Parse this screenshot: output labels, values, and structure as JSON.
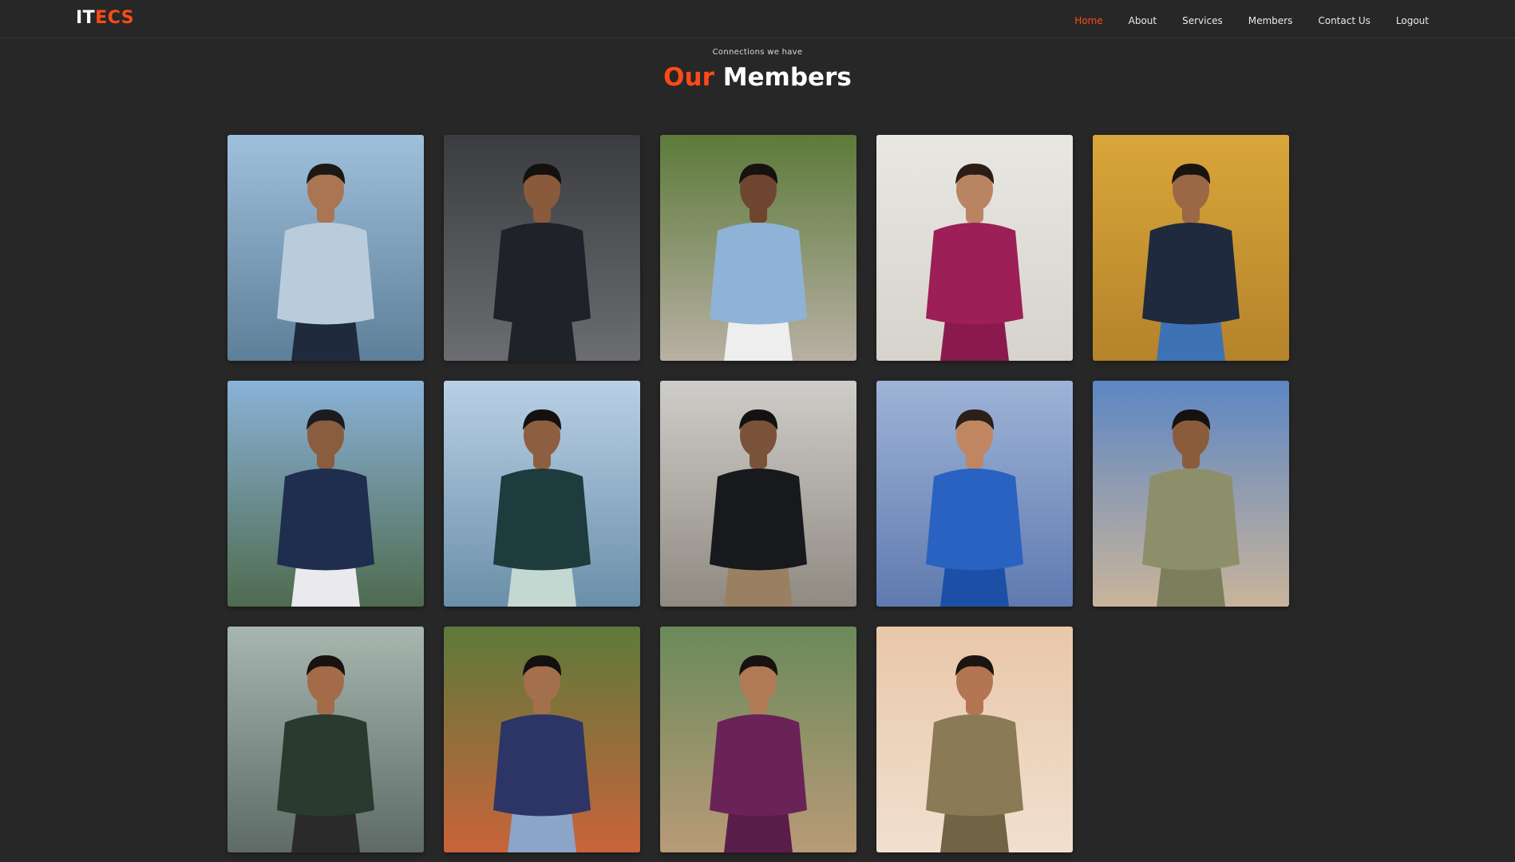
{
  "brand": {
    "part1": "IT",
    "part2": "ECS",
    "accent_color": "#ff4a17"
  },
  "nav": {
    "items": [
      {
        "label": "Home",
        "active": true
      },
      {
        "label": "About",
        "active": false
      },
      {
        "label": "Services",
        "active": false
      },
      {
        "label": "Members",
        "active": false
      },
      {
        "label": "Contact Us",
        "active": false
      },
      {
        "label": "Logout",
        "active": false
      }
    ]
  },
  "section": {
    "subtitle": "Connections we have",
    "title_accent": "Our",
    "title_rest": "Members"
  },
  "members": [
    {
      "photo": "man-seated-window-photo",
      "palette": {
        "bg1": "#9fc0dc",
        "bg2": "#5e7f98",
        "skin": "#a97553",
        "top": "#b9ccdc",
        "bottom": "#1f2b3d",
        "hair": "#1d1814"
      }
    },
    {
      "photo": "man-black-jacket-glasses-photo",
      "palette": {
        "bg1": "#3a3c40",
        "bg2": "#6c6d70",
        "skin": "#8a5a3c",
        "top": "#1f2228",
        "bottom": "#1f2228",
        "hair": "#141210"
      }
    },
    {
      "photo": "man-denim-jacket-sunglasses-photo",
      "palette": {
        "bg1": "#5d7a3a",
        "bg2": "#b8b0a4",
        "skin": "#6e4630",
        "top": "#8fb3d6",
        "bottom": "#eeeeee",
        "hair": "#151210"
      }
    },
    {
      "photo": "man-magenta-kurta-photo",
      "palette": {
        "bg1": "#e9e7e2",
        "bg2": "#d6d3cc",
        "skin": "#b98462",
        "top": "#9c1f57",
        "bottom": "#8a1a4d",
        "hair": "#2a1e16"
      }
    },
    {
      "photo": "man-temple-background-photo",
      "palette": {
        "bg1": "#d9a63a",
        "bg2": "#b5832a",
        "skin": "#9a6844",
        "top": "#1f2a3e",
        "bottom": "#3d73b5",
        "hair": "#1a1410"
      }
    },
    {
      "photo": "man-beanie-river-photo",
      "palette": {
        "bg1": "#8bb2d8",
        "bg2": "#4e6b4e",
        "skin": "#8a5d3f",
        "top": "#1f2d4f",
        "bottom": "#e9e9ee",
        "hair": "#1a1c22"
      }
    },
    {
      "photo": "man-floral-shirt-lake-photo",
      "palette": {
        "bg1": "#b9d0e6",
        "bg2": "#6a8fa8",
        "skin": "#8e5e40",
        "top": "#1e3b3d",
        "bottom": "#c4d8d2",
        "hair": "#15110e"
      }
    },
    {
      "photo": "man-black-hoodie-fog-photo",
      "palette": {
        "bg1": "#cfcdc9",
        "bg2": "#8f8a82",
        "skin": "#7a5238",
        "top": "#18191c",
        "bottom": "#9a8061",
        "hair": "#121212"
      }
    },
    {
      "photo": "man-blue-blazer-photo",
      "palette": {
        "bg1": "#9eb3d6",
        "bg2": "#5f7ab0",
        "skin": "#c08662",
        "top": "#2a62c2",
        "bottom": "#1c4fa6",
        "hair": "#2b1f18"
      }
    },
    {
      "photo": "man-olive-kurta-rooftop-photo",
      "palette": {
        "bg1": "#5c86c4",
        "bg2": "#c9b49a",
        "skin": "#8a5c3c",
        "top": "#8d8f6a",
        "bottom": "#7d7f5c",
        "hair": "#151210"
      }
    },
    {
      "photo": "man-airport-patterned-shirt-photo",
      "palette": {
        "bg1": "#a8b6b0",
        "bg2": "#5d6a66",
        "skin": "#a36b47",
        "top": "#2b3a2e",
        "bottom": "#2a2a2a",
        "hair": "#18130f"
      }
    },
    {
      "photo": "woman-plaid-shirt-garden-photo",
      "palette": {
        "bg1": "#5d7a3a",
        "bg2": "#c9633a",
        "skin": "#a46f4d",
        "top": "#2d3566",
        "bottom": "#8aa5c8",
        "hair": "#141010"
      }
    },
    {
      "photo": "woman-pirate-hat-photo",
      "palette": {
        "bg1": "#6a8a5a",
        "bg2": "#b99a78",
        "skin": "#b07a55",
        "top": "#6a2357",
        "bottom": "#5a1d4a",
        "hair": "#181210"
      }
    },
    {
      "photo": "woman-camo-top-sunset-photo",
      "palette": {
        "bg1": "#e9c7a9",
        "bg2": "#f0e0cf",
        "skin": "#b37552",
        "top": "#8a7a55",
        "bottom": "#6f6444",
        "hair": "#1c1410"
      }
    }
  ]
}
